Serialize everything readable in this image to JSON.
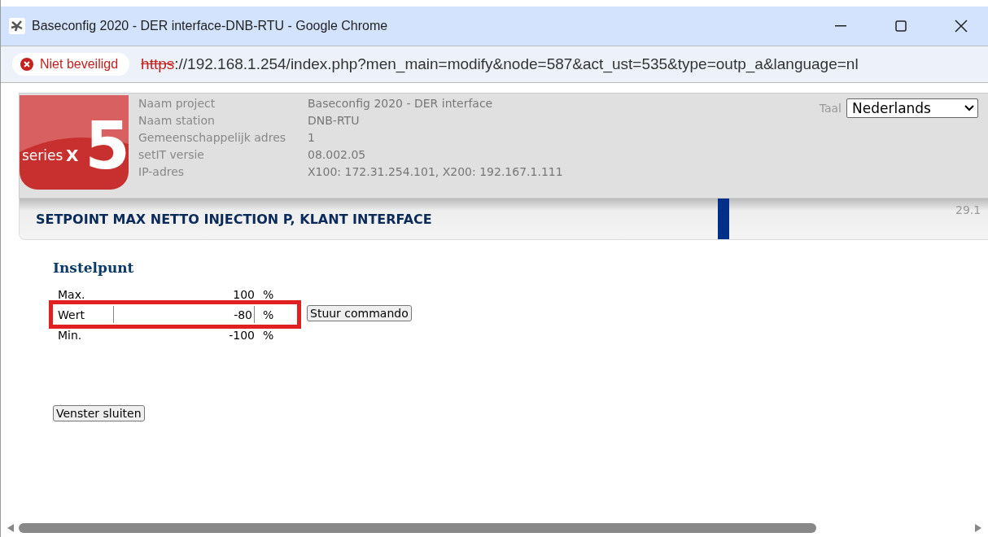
{
  "window": {
    "title": "Baseconfig 2020 - DER interface-DNB-RTU - Google Chrome"
  },
  "address_bar": {
    "security": "Niet beveiligd",
    "scheme": "https",
    "url_rest": "://192.168.1.254/index.php?men_main=modify&node=587&act_ust=535&type=outp_a&language=nl"
  },
  "logo": {
    "word": "series",
    "letter": "X",
    "numeral": "5"
  },
  "info": [
    {
      "label": "Naam project",
      "value": "Baseconfig 2020 - DER interface"
    },
    {
      "label": "Naam station",
      "value": "DNB-RTU"
    },
    {
      "label": "Gemeenschappelijk adres",
      "value": "1"
    },
    {
      "label": "setIT versie",
      "value": "08.002.05"
    },
    {
      "label": "IP-adres",
      "value": "X100: 172.31.254.101, X200: 192.167.1.111"
    }
  ],
  "language": {
    "label": "Taal",
    "value": "Nederlands"
  },
  "page_title": "SETPOINT MAX NETTO INJECTION P, KLANT INTERFACE",
  "date": "29.1",
  "section": "Instelpunt",
  "rows": [
    {
      "kind": "text",
      "label": "Max.",
      "value": "100",
      "unit": "%",
      "highlighted": false
    },
    {
      "kind": "input",
      "label": "Wert",
      "value": "-80",
      "unit": "%",
      "highlighted": true
    },
    {
      "kind": "text",
      "label": "Min.",
      "value": "-100",
      "unit": "%",
      "highlighted": false
    }
  ],
  "send_button": "Stuur commando",
  "close_button": "Venster sluiten"
}
